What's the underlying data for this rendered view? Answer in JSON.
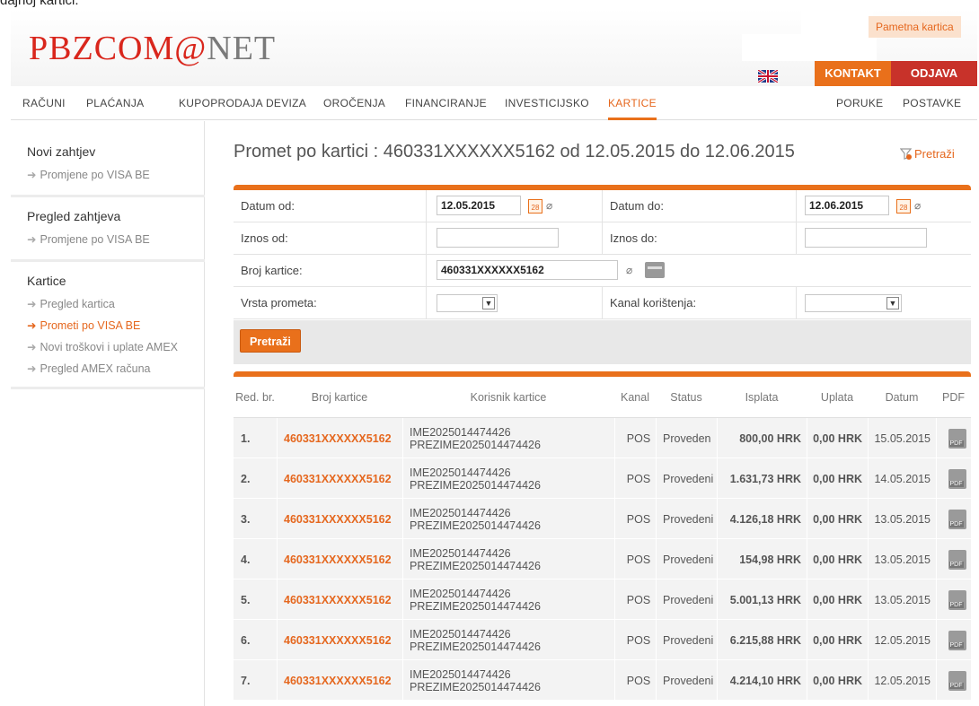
{
  "page_caption": "dajnoj kartici.",
  "header": {
    "logo_main": "PBZCOM",
    "logo_at": "@",
    "logo_end": "NET",
    "pametna_kartica": "Pametna kartica",
    "kontakt": "KONTAKT",
    "odjava": "ODJAVA",
    "flag_icon": "uk-flag-icon"
  },
  "nav": {
    "items": [
      "RAČUNI",
      "PLAĆANJA",
      "KUPOPRODAJA DEVIZA",
      "OROČENJA",
      "FINANCIRANJE",
      "INVESTICIJSKO",
      "KARTICE"
    ],
    "right_items": [
      "PORUKE",
      "POSTAVKE"
    ],
    "active": "KARTICE",
    "accent": "#e9701b"
  },
  "sidebar": {
    "sections": [
      {
        "title": "Novi zahtjev",
        "links": [
          "Promjene po VISA BE"
        ]
      },
      {
        "title": "Pregled zahtjeva",
        "links": [
          "Promjene po VISA BE"
        ]
      },
      {
        "title": "Kartice",
        "links": [
          "Pregled kartica",
          "Prometi po VISA BE",
          "Novi troškovi i uplate AMEX",
          "Pregled AMEX računa"
        ]
      }
    ],
    "active_link": "Prometi po VISA BE"
  },
  "content": {
    "title": "Promet po kartici : 460331XXXXXX5162 od 12.05.2015 do 12.06.2015",
    "search_link": "Pretraži"
  },
  "filter": {
    "datum_od_label": "Datum od:",
    "datum_od_value": "12.05.2015",
    "datum_do_label": "Datum do:",
    "datum_do_value": "12.06.2015",
    "iznos_od_label": "Iznos od:",
    "iznos_od_value": "",
    "iznos_do_label": "Iznos do:",
    "iznos_do_value": "",
    "broj_kartice_label": "Broj kartice:",
    "broj_kartice_value": "460331XXXXXX5162",
    "vrsta_prometa_label": "Vrsta prometa:",
    "vrsta_prometa_value": "",
    "kanal_label": "Kanal korištenja:",
    "kanal_value": "",
    "search_button": "Pretraži"
  },
  "table": {
    "headers": [
      "Red. br.",
      "Broj kartice",
      "Korisnik kartice",
      "Kanal",
      "Status",
      "Isplata",
      "Uplata",
      "Datum",
      "PDF"
    ],
    "rows": [
      {
        "rb": "1.",
        "card": "460331XXXXXX5162",
        "user1": "IME2025014474426",
        "user2": "PREZIME2025014474426",
        "kanal": "POS",
        "status": "Proveden",
        "isplata": "800,00 HRK",
        "uplata": "0,00 HRK",
        "datum": "15.05.2015"
      },
      {
        "rb": "2.",
        "card": "460331XXXXXX5162",
        "user1": "IME2025014474426",
        "user2": "PREZIME2025014474426",
        "kanal": "POS",
        "status": "Provedeni",
        "isplata": "1.631,73 HRK",
        "uplata": "0,00 HRK",
        "datum": "14.05.2015"
      },
      {
        "rb": "3.",
        "card": "460331XXXXXX5162",
        "user1": "IME2025014474426",
        "user2": "PREZIME2025014474426",
        "kanal": "POS",
        "status": "Provedeni",
        "isplata": "4.126,18 HRK",
        "uplata": "0,00 HRK",
        "datum": "13.05.2015"
      },
      {
        "rb": "4.",
        "card": "460331XXXXXX5162",
        "user1": "IME2025014474426",
        "user2": "PREZIME2025014474426",
        "kanal": "POS",
        "status": "Provedeni",
        "isplata": "154,98 HRK",
        "uplata": "0,00 HRK",
        "datum": "13.05.2015"
      },
      {
        "rb": "5.",
        "card": "460331XXXXXX5162",
        "user1": "IME2025014474426",
        "user2": "PREZIME2025014474426",
        "kanal": "POS",
        "status": "Provedeni",
        "isplata": "5.001,13 HRK",
        "uplata": "0,00 HRK",
        "datum": "13.05.2015"
      },
      {
        "rb": "6.",
        "card": "460331XXXXXX5162",
        "user1": "IME2025014474426",
        "user2": "PREZIME2025014474426",
        "kanal": "POS",
        "status": "Provedeni",
        "isplata": "6.215,88 HRK",
        "uplata": "0,00 HRK",
        "datum": "12.05.2015"
      },
      {
        "rb": "7.",
        "card": "460331XXXXXX5162",
        "user1": "IME2025014474426",
        "user2": "PREZIME2025014474426",
        "kanal": "POS",
        "status": "Provedeni",
        "isplata": "4.214,10 HRK",
        "uplata": "0,00 HRK",
        "datum": "12.05.2015"
      }
    ],
    "pdf_icon": "pdf-icon"
  }
}
